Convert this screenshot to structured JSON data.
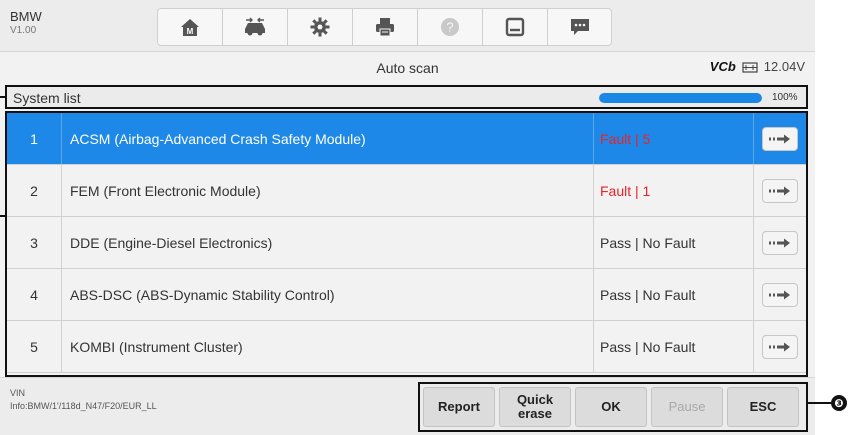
{
  "vehicle": {
    "make": "BMW",
    "version": "V1.00"
  },
  "toolbar": {
    "icons": [
      "home-icon",
      "vehicle-swap-icon",
      "gear-icon",
      "printer-icon",
      "help-icon",
      "save-icon",
      "message-icon"
    ]
  },
  "header": {
    "title": "Auto scan",
    "vci_label": "VCb",
    "battery_voltage": "12.04V"
  },
  "system_list": {
    "label": "System list",
    "progress_fraction": 1.0,
    "progress_text": "100%",
    "rows": [
      {
        "index": "1",
        "name": "ACSM (Airbag-Advanced Crash Safety Module)",
        "status": "Fault | 5",
        "fault": true,
        "selected": true
      },
      {
        "index": "2",
        "name": "FEM (Front Electronic Module)",
        "status": "Fault | 1",
        "fault": true,
        "selected": false
      },
      {
        "index": "3",
        "name": "DDE (Engine-Diesel Electronics)",
        "status": "Pass | No Fault",
        "fault": false,
        "selected": false
      },
      {
        "index": "4",
        "name": "ABS-DSC (ABS-Dynamic Stability Control)",
        "status": "Pass | No Fault",
        "fault": false,
        "selected": false
      },
      {
        "index": "5",
        "name": "KOMBI (Instrument Cluster)",
        "status": "Pass | No Fault",
        "fault": false,
        "selected": false
      }
    ]
  },
  "footer": {
    "vin_label": "VIN",
    "vin_info": "Info:BMW/1'/118d_N47/F20/EUR_LL",
    "buttons": {
      "report": "Report",
      "quick_erase_line1": "Quick",
      "quick_erase_line2": "erase",
      "ok": "OK",
      "pause": "Pause",
      "esc": "ESC"
    }
  },
  "callout_badge": "❸",
  "colors": {
    "accent": "#1e88e8",
    "fault": "#e8232a",
    "battery_green": "#3a9a3a"
  }
}
